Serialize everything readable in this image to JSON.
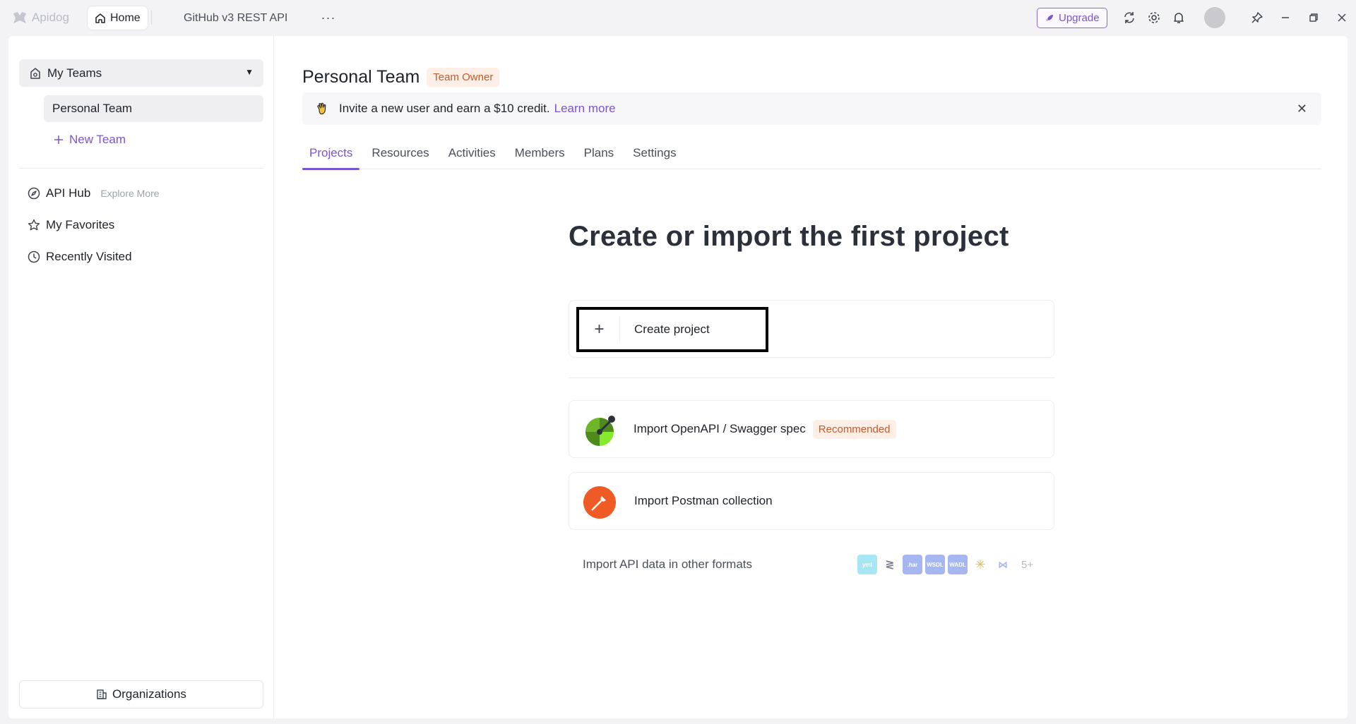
{
  "app": {
    "logo_text": "Apidog"
  },
  "topbar": {
    "home_tab": "Home",
    "project_tab": "GitHub v3 REST API",
    "more": "···",
    "upgrade_label": "Upgrade"
  },
  "sidebar": {
    "my_teams": "My Teams",
    "personal_team": "Personal Team",
    "new_team": "New Team",
    "api_hub": "API Hub",
    "explore_more": "Explore More",
    "favorites": "My Favorites",
    "recently_visited": "Recently Visited",
    "organizations": "Organizations"
  },
  "main": {
    "team_title": "Personal Team",
    "owner_badge": "Team Owner",
    "invite_text": "Invite a new user and earn a $10 credit.",
    "invite_link": "Learn more",
    "tabs": [
      {
        "label": "Projects",
        "active": true
      },
      {
        "label": "Resources"
      },
      {
        "label": "Activities"
      },
      {
        "label": "Members"
      },
      {
        "label": "Plans"
      },
      {
        "label": "Settings"
      }
    ],
    "hero": "Create or import the first project",
    "create_project": "Create project",
    "import_swagger": "Import OpenAPI / Swagger spec",
    "recommended": "Recommended",
    "import_postman": "Import Postman collection",
    "other_formats": "Import API data in other formats",
    "format_icons": [
      "yaml-icon",
      "stoplight-icon",
      "har-icon",
      "wsdl-icon",
      "wadl-icon",
      "insomnia-icon",
      "raml-icon"
    ],
    "more_formats": "5+"
  },
  "colors": {
    "accent": "#7a55cf",
    "badge_text": "#c55a2a",
    "badge_bg": "#fdeee6",
    "postman": "#ef5b25",
    "swagger": "#85ea2d"
  }
}
